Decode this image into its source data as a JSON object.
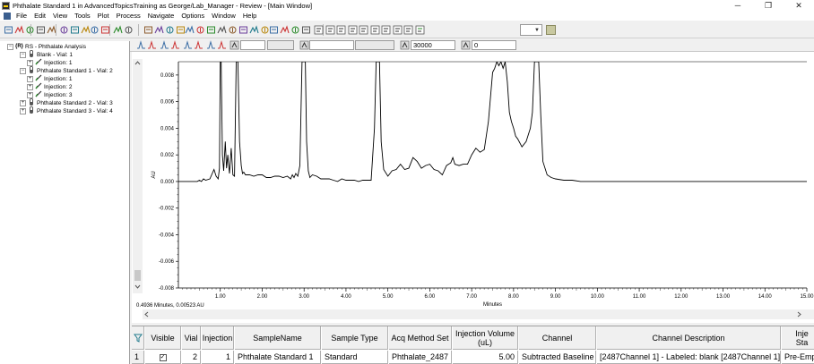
{
  "window": {
    "title": "Phthalate Standard 1 in AdvancedTopicsTraining as George/Lab_Manager - Review - [Main Window]",
    "minimize": "─",
    "restore": "❐",
    "close": "✕"
  },
  "menu": [
    "File",
    "Edit",
    "View",
    "Tools",
    "Plot",
    "Process",
    "Navigate",
    "Options",
    "Window",
    "Help"
  ],
  "toolbar2": {
    "field1": "30000",
    "field2": "0"
  },
  "tree": {
    "root": "RS - Phthalate Analysis",
    "nodes": [
      {
        "label": "Blank - Vial: 1",
        "level": 1
      },
      {
        "label": "Injection: 1",
        "level": 2
      },
      {
        "label": "Phthalate Standard 1 - Vial: 2",
        "level": 1
      },
      {
        "label": "Injection: 1",
        "level": 2
      },
      {
        "label": "Injection: 2",
        "level": 2
      },
      {
        "label": "Injection: 3",
        "level": 2
      },
      {
        "label": "Phthalate Standard 2 - Vial: 3",
        "level": 1
      },
      {
        "label": "Phthalate Standard 3 - Vial: 4",
        "level": 1
      }
    ]
  },
  "chart_data": {
    "type": "line",
    "xlabel": "Minutes",
    "ylabel": "AU",
    "xlim": [
      0,
      15.0
    ],
    "ylim": [
      -0.008,
      0.009
    ],
    "xticks": [
      "1.00",
      "2.00",
      "3.00",
      "4.00",
      "5.00",
      "6.00",
      "7.00",
      "8.00",
      "9.00",
      "10.00",
      "11.00",
      "12.00",
      "13.00",
      "14.00",
      "15.00"
    ],
    "yticks": [
      "0.008",
      "0.006",
      "0.004",
      "0.002",
      "0.000",
      "-0.002",
      "-0.004",
      "-0.006",
      "-0.008"
    ],
    "series": [
      {
        "color": "#000000",
        "x": [
          0.0,
          0.3,
          0.45,
          0.5,
          0.55,
          0.6,
          0.65,
          0.75,
          0.85,
          0.9,
          0.95,
          0.98,
          1.0,
          1.02,
          1.05,
          1.08,
          1.12,
          1.15,
          1.18,
          1.2,
          1.22,
          1.26,
          1.3,
          1.34,
          1.38,
          1.42,
          1.46,
          1.5,
          1.53,
          1.56,
          1.6,
          1.7,
          1.8,
          1.9,
          2.0,
          2.1,
          2.2,
          2.3,
          2.4,
          2.5,
          2.6,
          2.68,
          2.72,
          2.76,
          2.8,
          2.85,
          2.9,
          2.95,
          2.98,
          3.0,
          3.03,
          3.06,
          3.1,
          3.14,
          3.2,
          3.3,
          3.4,
          3.5,
          3.6,
          3.7,
          3.8,
          3.9,
          4.0,
          4.1,
          4.2,
          4.3,
          4.4,
          4.5,
          4.6,
          4.68,
          4.72,
          4.76,
          4.8,
          4.84,
          4.9,
          5.0,
          5.1,
          5.2,
          5.3,
          5.4,
          5.5,
          5.6,
          5.7,
          5.8,
          5.9,
          6.0,
          6.1,
          6.2,
          6.3,
          6.4,
          6.5,
          6.55,
          6.6,
          6.7,
          6.8,
          6.9,
          7.0,
          7.1,
          7.2,
          7.3,
          7.4,
          7.5,
          7.55,
          7.6,
          7.65,
          7.7,
          7.75,
          7.8,
          7.85,
          7.9,
          7.95,
          8.0,
          8.05,
          8.1,
          8.2,
          8.3,
          8.4,
          8.45,
          8.5,
          8.55,
          8.6,
          8.65,
          8.7,
          8.8,
          8.9,
          9.0,
          9.2,
          9.4,
          9.6,
          9.8,
          10.0,
          10.5,
          11.0,
          12.0,
          13.0,
          14.0,
          15.0
        ],
        "y": [
          0.0,
          0.0,
          0.0,
          0.0001,
          0.0,
          0.0002,
          0.0001,
          0.0002,
          0.0009,
          0.0004,
          0.0002,
          0.001,
          0.009,
          0.009,
          0.002,
          0.0008,
          0.003,
          0.001,
          0.002,
          0.0012,
          0.0006,
          0.0025,
          0.0005,
          0.0004,
          0.009,
          0.009,
          0.003,
          0.0012,
          0.0006,
          0.0007,
          0.0005,
          0.0005,
          0.0004,
          0.0005,
          0.0005,
          0.0003,
          0.0003,
          0.0004,
          0.0004,
          0.0003,
          0.0004,
          0.0002,
          0.0005,
          0.0003,
          0.0006,
          0.0004,
          0.0012,
          0.009,
          0.009,
          0.009,
          0.009,
          0.003,
          0.0008,
          0.0003,
          0.0005,
          0.0004,
          0.0002,
          0.0002,
          0.0002,
          0.0001,
          0.0,
          0.0002,
          0.0001,
          0.0001,
          0.0001,
          0.0,
          0.0001,
          0.0001,
          0.0001,
          0.004,
          0.009,
          0.009,
          0.009,
          0.003,
          0.0009,
          0.0004,
          0.0008,
          0.0009,
          0.0013,
          0.0009,
          0.001,
          0.0018,
          0.0015,
          0.001,
          0.0012,
          0.0013,
          0.0009,
          0.0008,
          0.0005,
          0.0012,
          0.0014,
          0.0018,
          0.0013,
          0.0012,
          0.0013,
          0.0013,
          0.002,
          0.0025,
          0.0022,
          0.0024,
          0.0045,
          0.0082,
          0.0085,
          0.009,
          0.0087,
          0.009,
          0.0085,
          0.009,
          0.0075,
          0.0052,
          0.0045,
          0.004,
          0.0034,
          0.0032,
          0.0026,
          0.003,
          0.004,
          0.0052,
          0.009,
          0.009,
          0.009,
          0.005,
          0.0015,
          0.0005,
          0.0003,
          0.0002,
          0.0001,
          0.0001,
          0.0,
          0.0,
          0.0,
          0.0,
          0.0,
          0.0,
          0.0,
          0.0,
          0.0
        ]
      }
    ],
    "grid": false
  },
  "cursor_readout": "0.4936 Minutes, 0.00523 AU",
  "table": {
    "headers": [
      "",
      "Visible",
      "Vial",
      "Injection",
      "SampleName",
      "Sample Type",
      "Acq Method Set",
      "Injection Volume (uL)",
      "Channel",
      "Channel Description",
      "Inje Sta"
    ],
    "rows": [
      [
        "1",
        "✓",
        "2",
        "1",
        "Phthalate Standard 1",
        "Standard",
        "Phthalate_2487",
        "5.00",
        "Subtracted Baseline",
        "[2487Channel 1] - Labeled: blank [2487Channel 1]",
        "Pre-Empov"
      ]
    ]
  }
}
